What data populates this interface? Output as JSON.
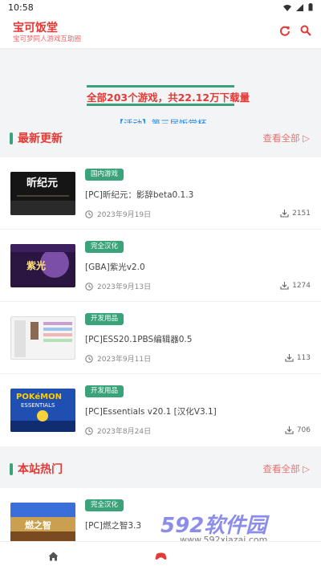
{
  "status": {
    "time": "10:58"
  },
  "colors": {
    "accent": "#e53935",
    "green": "#3aa37a",
    "link": "#1e88e5"
  },
  "header": {
    "title": "宝可饭堂",
    "subtitle": "宝可梦同人游戏互助圈",
    "refresh_icon": "refresh-icon",
    "search_icon": "search-icon"
  },
  "banner": {
    "stats": "全部203个游戏，共22.12万下载量",
    "activity": "【活动】第三届饭堂杯"
  },
  "latest": {
    "title": "最新更新",
    "see_all": "查看全部 ▷",
    "items": [
      {
        "tag": "国内游戏",
        "title": "[PC]昕纪元：影辞beta0.1.3",
        "date": "2023年9月19日",
        "downloads": "2151"
      },
      {
        "tag": "完全汉化",
        "title": "[GBA]紫光v2.0",
        "date": "2023年9月13日",
        "downloads": "1274"
      },
      {
        "tag": "开发用品",
        "title": "[PC]ESS20.1PBS编辑器0.5",
        "date": "2023年9月11日",
        "downloads": "113"
      },
      {
        "tag": "开发用品",
        "title": "[PC]Essentials v20.1 [汉化V3.1]",
        "date": "2023年8月24日",
        "downloads": "706"
      }
    ]
  },
  "popular": {
    "title": "本站热门",
    "see_all": "查看全部 ▷",
    "items": [
      {
        "tag": "完全汉化",
        "title": "[PC]燃之智3.3"
      }
    ]
  },
  "thumbs": {
    "t0_text": "昕纪元",
    "t1_text": "紫光",
    "t3_text": "POKéMON",
    "t3_sub": "ESSENTIALS",
    "t4_text": "燃之智"
  },
  "watermark": {
    "brand": "592软件园",
    "url": "www.592xiazai.com"
  },
  "nav": {
    "home_icon": "home-icon",
    "game_icon": "game-icon"
  }
}
